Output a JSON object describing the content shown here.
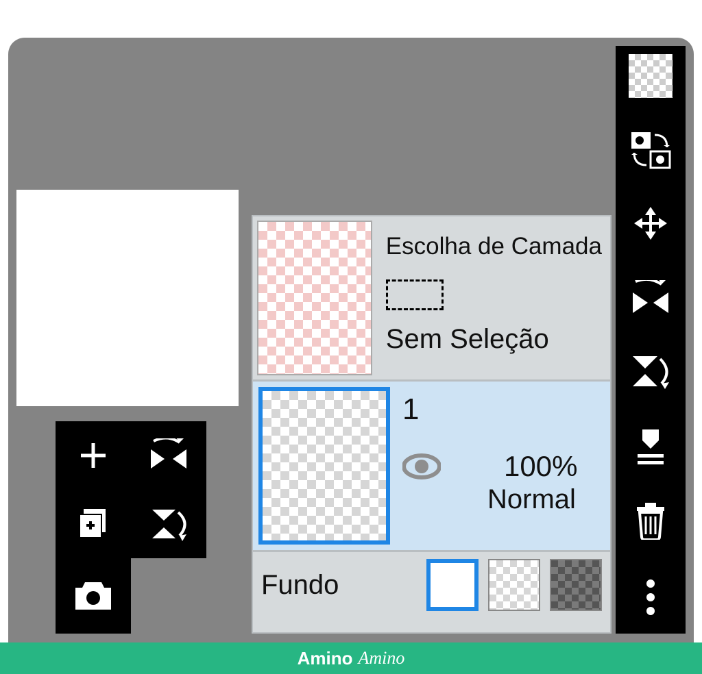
{
  "layers_panel": {
    "header": "Escolha de Camada",
    "no_selection": "Sem Seleção",
    "active_layer": {
      "name": "1",
      "opacity": "100%",
      "blend_mode": "Normal"
    },
    "background_label": "Fundo"
  },
  "watermark": {
    "brand_bold": "Amino",
    "brand_cursive": "Amino"
  }
}
